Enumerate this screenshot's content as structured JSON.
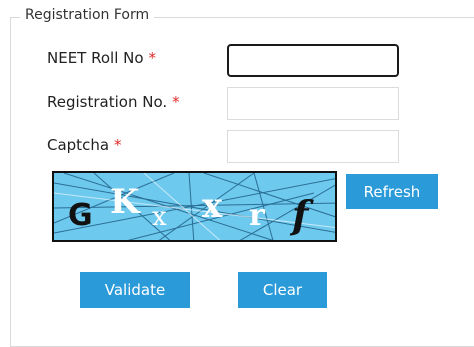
{
  "form": {
    "legend": "Registration Form",
    "fields": [
      {
        "label": "NEET Roll No",
        "required_mark": "*",
        "value": ""
      },
      {
        "label": "Registration No.",
        "required_mark": "*",
        "value": ""
      },
      {
        "label": "Captcha",
        "required_mark": "*",
        "value": ""
      }
    ],
    "captcha_text": "GKxxrf",
    "captcha_chars": [
      "G",
      "K",
      "x",
      "x",
      "r",
      "f"
    ],
    "refresh_label": "Refresh",
    "validate_label": "Validate",
    "clear_label": "Clear"
  },
  "colors": {
    "button": "#2b9ad9",
    "captcha_bg": "#6ec9ee",
    "required": "#e02b2b"
  }
}
